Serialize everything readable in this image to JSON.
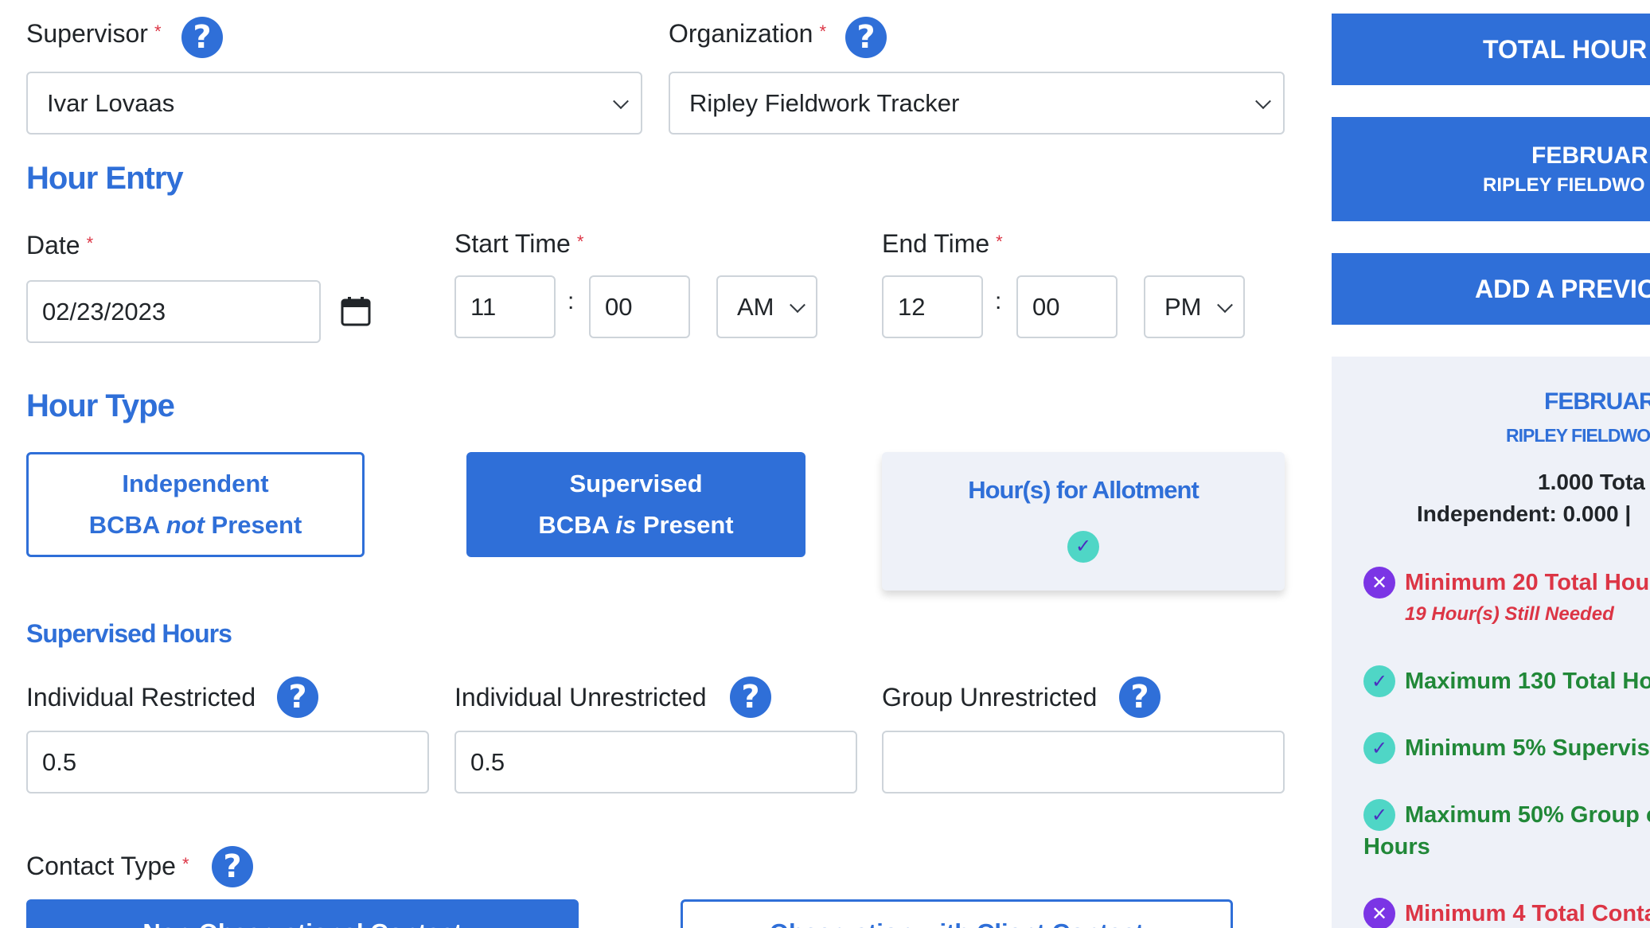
{
  "form": {
    "supervisor": {
      "label": "Supervisor",
      "required": "*",
      "value": "Ivar Lovaas"
    },
    "organization": {
      "label": "Organization",
      "required": "*",
      "value": "Ripley Fieldwork Tracker"
    },
    "hour_entry_title": "Hour Entry",
    "date": {
      "label": "Date",
      "required": "*",
      "value": "02/23/2023"
    },
    "start_time": {
      "label": "Start Time",
      "required": "*",
      "hour": "11",
      "separator": ":",
      "minute": "00",
      "period": "AM"
    },
    "end_time": {
      "label": "End Time",
      "required": "*",
      "hour": "12",
      "separator": ":",
      "minute": "00",
      "period": "PM"
    },
    "hour_type_title": "Hour Type",
    "hour_types": {
      "independent": {
        "line1": "Independent",
        "line2_pre": "BCBA ",
        "line2_em": "not",
        "line2_post": " Present"
      },
      "supervised": {
        "line1": "Supervised",
        "line2_pre": "BCBA ",
        "line2_em": "is",
        "line2_post": " Present"
      },
      "allotment": {
        "label": "Hour(s) for Allotment",
        "check": "✓"
      }
    },
    "supervised_hours_title": "Supervised Hours",
    "individual_restricted": {
      "label": "Individual Restricted",
      "value": "0.5"
    },
    "individual_unrestricted": {
      "label": "Individual Unrestricted",
      "value": "0.5"
    },
    "group_unrestricted": {
      "label": "Group Unrestricted",
      "value": ""
    },
    "contact_type": {
      "label": "Contact Type",
      "required": "*",
      "option1": "Non-Observational Contact",
      "option2": "Observation with Client Contact"
    }
  },
  "sidebar": {
    "total_hours_button": "TOTAL HOUR",
    "month_button": {
      "line1": "FEBRUAR",
      "line2": "RIPLEY FIELDWO"
    },
    "add_previous_button": "ADD A PREVIO",
    "summary": {
      "month": "FEBRUAR",
      "org": "RIPLEY FIELDWO",
      "total_line": "1.000 Tota",
      "breakdown_line": "Independent: 0.000 |",
      "requirements": [
        {
          "status": "fail",
          "icon": "✕",
          "text": "Minimum 20 Total Hou",
          "note": "19 Hour(s) Still Needed"
        },
        {
          "status": "pass",
          "icon": "✓",
          "text": "Maximum 130 Total Ho"
        },
        {
          "status": "pass",
          "icon": "✓",
          "text": "Minimum 5% Supervis"
        },
        {
          "status": "pass",
          "icon": "✓",
          "text": "Maximum 50% Group c",
          "text2": "Hours"
        },
        {
          "status": "fail",
          "icon": "✕",
          "text": "Minimum 4 Total Conta"
        }
      ]
    }
  },
  "colors": {
    "primary": "#2f6fd8",
    "required": "#dc3545",
    "pass": "#218838",
    "fail": "#dc3545",
    "panel": "#eef1f8"
  }
}
